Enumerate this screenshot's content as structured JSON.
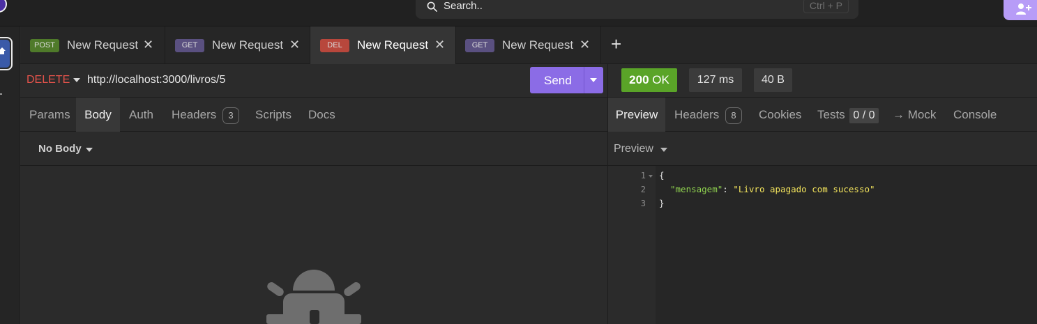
{
  "search": {
    "placeholder": "Search..",
    "shortcut": "Ctrl + P"
  },
  "tabs": [
    {
      "method": "POST",
      "method_color": "#4f7a2a",
      "name": "New Request",
      "active": false
    },
    {
      "method": "GET",
      "method_color": "#5a5080",
      "name": "New Request",
      "active": false
    },
    {
      "method": "DEL",
      "method_color": "#b8473c",
      "name": "New Request",
      "active": true
    },
    {
      "method": "GET",
      "method_color": "#5a5080",
      "name": "New Request",
      "active": false
    }
  ],
  "request": {
    "method": "DELETE",
    "url": "http://localhost:3000/livros/5",
    "send_label": "Send"
  },
  "request_tabs": {
    "params": "Params",
    "body": "Body",
    "auth": "Auth",
    "headers": "Headers",
    "headers_count": "3",
    "scripts": "Scripts",
    "docs": "Docs",
    "active": "Body"
  },
  "body": {
    "mode": "No Body"
  },
  "response": {
    "status_code": "200",
    "status_text": "OK",
    "time": "127 ms",
    "size": "40 B"
  },
  "response_tabs": {
    "preview": "Preview",
    "headers": "Headers",
    "headers_count": "8",
    "cookies": "Cookies",
    "tests": "Tests",
    "tests_count": "0 / 0",
    "mock": "→ Mock",
    "console": "Console",
    "active": "Preview"
  },
  "preview": {
    "mode": "Preview",
    "line_numbers": [
      "1",
      "2",
      "3"
    ],
    "lines": {
      "open": "{",
      "key": "\"mensagem\"",
      "colon": ": ",
      "value": "\"Livro apagado com sucesso\"",
      "close": "}"
    }
  },
  "colors": {
    "accent": "#8b6ce6",
    "ok": "#5aa428",
    "delete": "#e5534b",
    "json_key": "#8fd14f",
    "json_string": "#f2e35c"
  }
}
